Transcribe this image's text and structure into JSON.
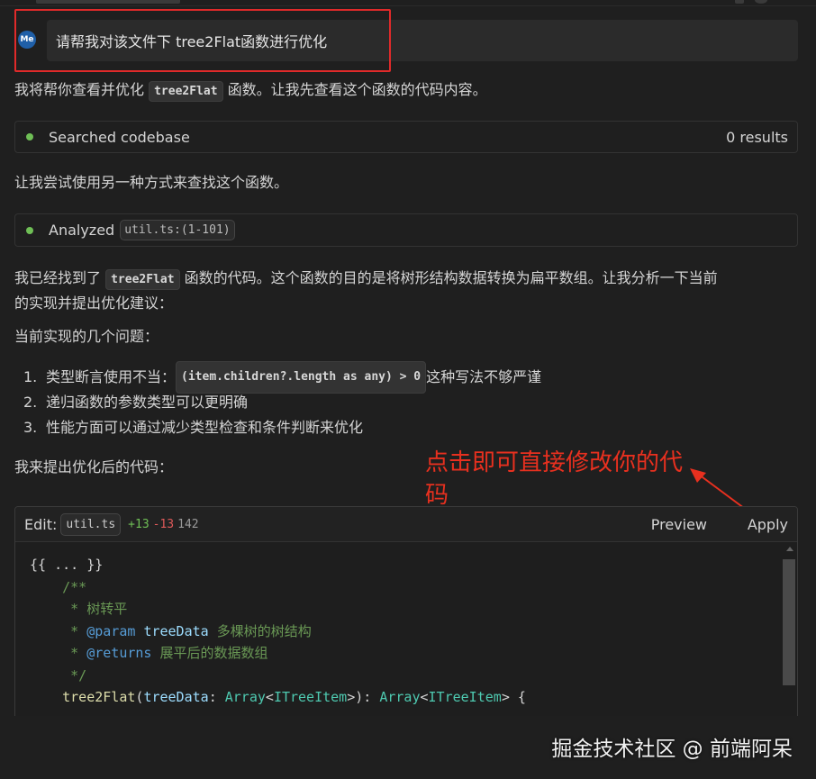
{
  "user_message": {
    "avatar_text": "Me",
    "text": "请帮我对该文件下 tree2Flat函数进行优化"
  },
  "assistant": {
    "intro_before": "我将帮你查看并优化 ",
    "intro_code": "tree2Flat",
    "intro_after": " 函数。让我先查看这个函数的代码内容。",
    "tool1": {
      "label": "Searched codebase",
      "result": "0 results"
    },
    "retry_text": "让我尝试使用另一种方式来查找这个函数。",
    "tool2": {
      "label": "Analyzed",
      "file": "util.ts:(1-101)"
    },
    "found_before": "我已经找到了 ",
    "found_code": "tree2Flat",
    "found_after_line1": " 函数的代码。这个函数的目的是将树形结构数据转换为扁平数组。让我分析一下当前",
    "found_line2": "的实现并提出优化建议：",
    "issues_heading": "当前实现的几个问题：",
    "issues": [
      {
        "num": "1.",
        "before": "类型断言使用不当：",
        "code": "(item.children?.length as any) > 0",
        "after": " 这种写法不够严谨"
      },
      {
        "num": "2.",
        "text": "递归函数的参数类型可以更明确"
      },
      {
        "num": "3.",
        "text": "性能方面可以通过减少类型检查和条件判断来优化"
      }
    ],
    "proposal_text": "我来提出优化后的代码："
  },
  "annotation": {
    "text": "点击即可直接修改你的代码",
    "color": "#e8301f"
  },
  "edit_panel": {
    "label": "Edit:",
    "file": "util.ts",
    "added": "+13",
    "removed": "-13",
    "total": "142",
    "preview_label": "Preview",
    "apply_label": "Apply"
  },
  "code_lines": [
    {
      "text": "{{ ... }}"
    },
    {
      "text": "    /**"
    },
    {
      "text": "     * 树转平"
    },
    {
      "text": "     * @param treeData 多棵树的树结构"
    },
    {
      "text": "     * @returns 展平后的数据数组"
    },
    {
      "text": "     */"
    },
    {
      "text": "    tree2Flat(treeData: Array<ITreeItem>): Array<ITreeItem> {"
    }
  ],
  "watermark": "掘金技术社区 @ 前端阿呆",
  "colors": {
    "background": "#1f1f1f",
    "highlight_border": "#e02a2a",
    "success_dot": "#6fbf56",
    "added": "#6fbf56",
    "removed": "#e05a5a"
  }
}
